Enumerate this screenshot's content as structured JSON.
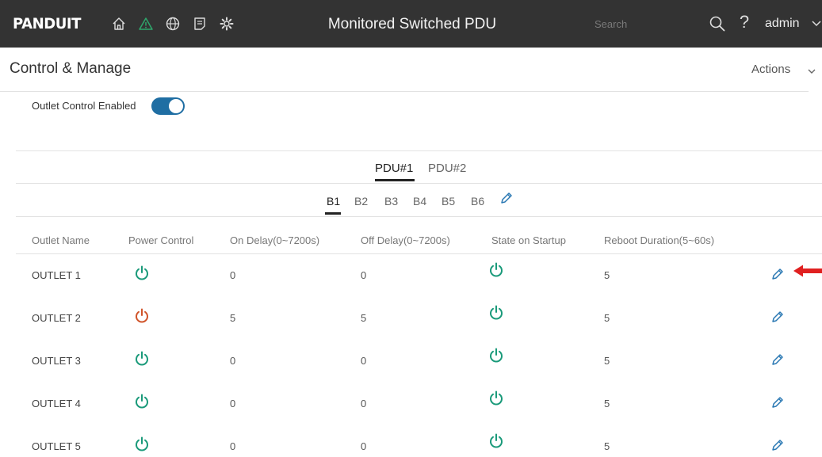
{
  "header": {
    "logo": "PANDUIT",
    "title": "Monitored Switched PDU",
    "search_placeholder": "Search",
    "user": "admin",
    "nav_icons": [
      "home-icon",
      "alarm-warning-icon",
      "globe-icon",
      "document-icon",
      "settings-gear-icon"
    ]
  },
  "page": {
    "title": "Control & Manage",
    "actions_label": "Actions"
  },
  "outlet_control": {
    "label": "Outlet Control Enabled",
    "enabled": true
  },
  "pdu_tabs": [
    {
      "label": "PDU#1",
      "active": true
    },
    {
      "label": "PDU#2",
      "active": false
    }
  ],
  "bank_tabs": [
    {
      "label": "B1",
      "active": true
    },
    {
      "label": "B2",
      "active": false
    },
    {
      "label": "B3",
      "active": false
    },
    {
      "label": "B4",
      "active": false
    },
    {
      "label": "B5",
      "active": false
    },
    {
      "label": "B6",
      "active": false
    }
  ],
  "table": {
    "columns": [
      "Outlet Name",
      "Power Control",
      "On Delay(0~7200s)",
      "Off Delay(0~7200s)",
      "State on Startup",
      "Reboot Duration(5~60s)"
    ],
    "rows": [
      {
        "name": "OUTLET 1",
        "power": "on",
        "on_delay": "0",
        "off_delay": "0",
        "startup": "on",
        "reboot": "5"
      },
      {
        "name": "OUTLET 2",
        "power": "off",
        "on_delay": "5",
        "off_delay": "5",
        "startup": "on",
        "reboot": "5"
      },
      {
        "name": "OUTLET 3",
        "power": "on",
        "on_delay": "0",
        "off_delay": "0",
        "startup": "on",
        "reboot": "5"
      },
      {
        "name": "OUTLET 4",
        "power": "on",
        "on_delay": "0",
        "off_delay": "0",
        "startup": "on",
        "reboot": "5"
      },
      {
        "name": "OUTLET 5",
        "power": "on",
        "on_delay": "0",
        "off_delay": "0",
        "startup": "on",
        "reboot": "5"
      }
    ]
  },
  "colors": {
    "topbar": "#333333",
    "power_on": "#1a9a7a",
    "power_off": "#d0542a",
    "toggle_on": "#1f6ea3",
    "warning": "#2ea66b",
    "annotation_arrow": "#e02020"
  }
}
